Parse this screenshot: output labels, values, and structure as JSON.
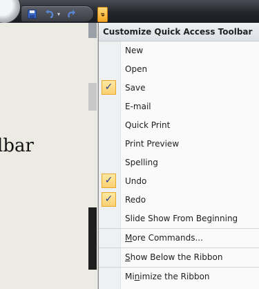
{
  "menu": {
    "title": "Customize Quick Access Toolbar",
    "check_glyph": "✓",
    "items": [
      {
        "label": "New",
        "checked": false
      },
      {
        "label": "Open",
        "checked": false
      },
      {
        "label": "Save",
        "checked": true
      },
      {
        "label": "E-mail",
        "checked": false
      },
      {
        "label": "Quick Print",
        "checked": false
      },
      {
        "label": "Print Preview",
        "checked": false
      },
      {
        "label": "Spelling",
        "checked": false
      },
      {
        "label": "Undo",
        "checked": true
      },
      {
        "label": "Redo",
        "checked": true
      },
      {
        "label": "Slide Show From Beginning",
        "checked": false
      }
    ],
    "commands": {
      "more": {
        "pre": "",
        "key": "M",
        "post": "ore Commands..."
      },
      "show_below": {
        "pre": "",
        "key": "S",
        "post": "how Below the Ribbon"
      },
      "minimize": {
        "pre": "Mi",
        "key": "n",
        "post": "imize the Ribbon"
      }
    }
  },
  "background": {
    "partial_text": "lbar"
  },
  "icons": {
    "save": "floppy-disk-icon",
    "undo": "undo-icon",
    "redo": "redo-icon",
    "customize": "customize-dropdown-icon"
  },
  "colors": {
    "check_fill": "#fcd072",
    "check_border": "#e8a826",
    "accent": "#f5a623"
  }
}
